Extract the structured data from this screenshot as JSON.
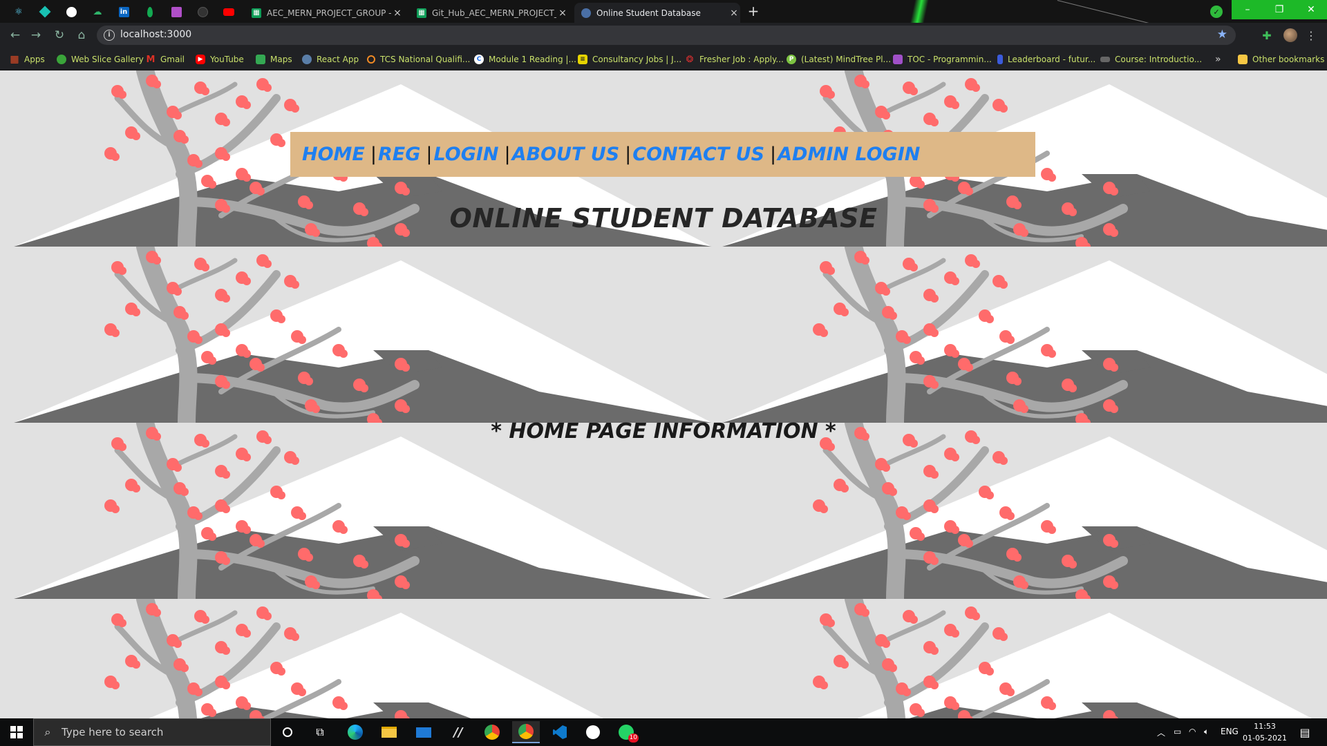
{
  "browser": {
    "tabs": [
      {
        "title": "AEC_MERN_PROJECT_GROUP - G",
        "close": "×",
        "favicon": "sheets-icon"
      },
      {
        "title": "Git_Hub_AEC_MERN_PROJECT_G",
        "close": "×",
        "favicon": "sheets-icon"
      },
      {
        "title": "Online Student Database",
        "close": "×",
        "favicon": "react-globe-icon",
        "active": true
      }
    ],
    "new_tab": "+",
    "window_controls": {
      "minimize": "–",
      "restore": "❐",
      "close": "✕"
    },
    "url": "localhost:3000",
    "bookmarks": [
      {
        "label": "Apps",
        "icon": "apps-grid-icon",
        "color": "#e34c26"
      },
      {
        "label": "Web Slice Gallery",
        "icon": "web-slice-icon",
        "color": "#3aa43a"
      },
      {
        "label": "Gmail",
        "icon": "gmail-icon",
        "color": "#d93025"
      },
      {
        "label": "YouTube",
        "icon": "youtube-icon",
        "color": "#ff0000"
      },
      {
        "label": "Maps",
        "icon": "maps-icon",
        "color": "#34a853"
      },
      {
        "label": "React App",
        "icon": "react-icon",
        "color": "#61dafb"
      },
      {
        "label": "TCS National Qualifi...",
        "icon": "tcs-icon",
        "color": "#f08a24"
      },
      {
        "label": "Module 1 Reading |...",
        "icon": "coursera-icon",
        "color": "#1f6feb"
      },
      {
        "label": "Consultancy Jobs | J...",
        "icon": "jobs-icon",
        "color": "#e6d400"
      },
      {
        "label": "Fresher Job : Apply...",
        "icon": "fresher-icon",
        "color": "#d32f2f"
      },
      {
        "label": "(Latest) MindTree Pl...",
        "icon": "mindtree-icon",
        "color": "#7cc242"
      },
      {
        "label": "TOC - Programmin...",
        "icon": "toc-icon",
        "color": "#a050c8"
      },
      {
        "label": "Leaderboard - futur...",
        "icon": "leaderboard-icon",
        "color": "#3b5bdb"
      },
      {
        "label": "Course: Introductio...",
        "icon": "course-icon",
        "color": "#666666"
      }
    ],
    "more_bookmarks": "»",
    "other_bookmarks": "Other bookmarks"
  },
  "page": {
    "nav": [
      {
        "label": "HOME"
      },
      {
        "label": "REG"
      },
      {
        "label": "LOGIN"
      },
      {
        "label": "ABOUT US"
      },
      {
        "label": "CONTACT US"
      },
      {
        "label": "ADMIN LOGIN"
      }
    ],
    "nav_separator": "|",
    "title": "ONLINE STUDENT DATABASE",
    "home_info": "* HOME PAGE INFORMATION *",
    "colors": {
      "navbar_bg": "#deb887",
      "nav_link": "#1e7ff0",
      "blossom": "#ff6b6b",
      "mountain": "#6b6b6b",
      "snow": "#ffffff",
      "branch": "#a8a8a8",
      "page_bg": "#e1e1e1"
    }
  },
  "taskbar": {
    "search_placeholder": "Type here to search",
    "language": "ENG",
    "time": "11:53",
    "date": "01-05-2021",
    "whatsapp_badge": "10"
  }
}
